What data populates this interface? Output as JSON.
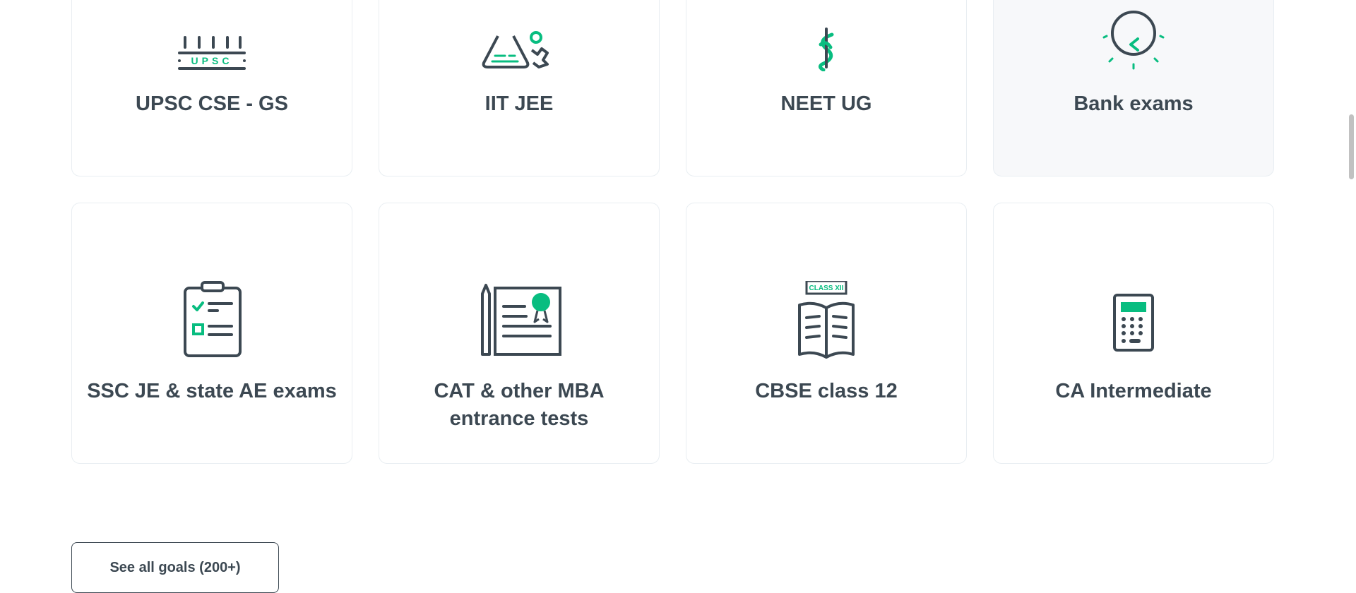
{
  "goals": [
    {
      "label": "UPSC CSE - GS",
      "icon": "upsc-pillars-icon",
      "upsc_text": "UPSC"
    },
    {
      "label": "IIT JEE",
      "icon": "flask-gear-icon"
    },
    {
      "label": "NEET UG",
      "icon": "caduceus-icon"
    },
    {
      "label": "Bank exams",
      "icon": "rupee-coin-icon"
    },
    {
      "label": "SSC JE & state AE exams",
      "icon": "clipboard-checklist-icon"
    },
    {
      "label": "CAT & other MBA entrance tests",
      "icon": "certificate-icon"
    },
    {
      "label": "CBSE class 12",
      "icon": "open-book-icon",
      "badge_text": "CLASS XII"
    },
    {
      "label": "CA Intermediate",
      "icon": "calculator-icon"
    }
  ],
  "see_all_label": "See all goals (200+)",
  "colors": {
    "accent": "#08bd80",
    "text": "#3c4852",
    "border": "#e9eef2",
    "hover_bg": "#f7f8fa"
  }
}
